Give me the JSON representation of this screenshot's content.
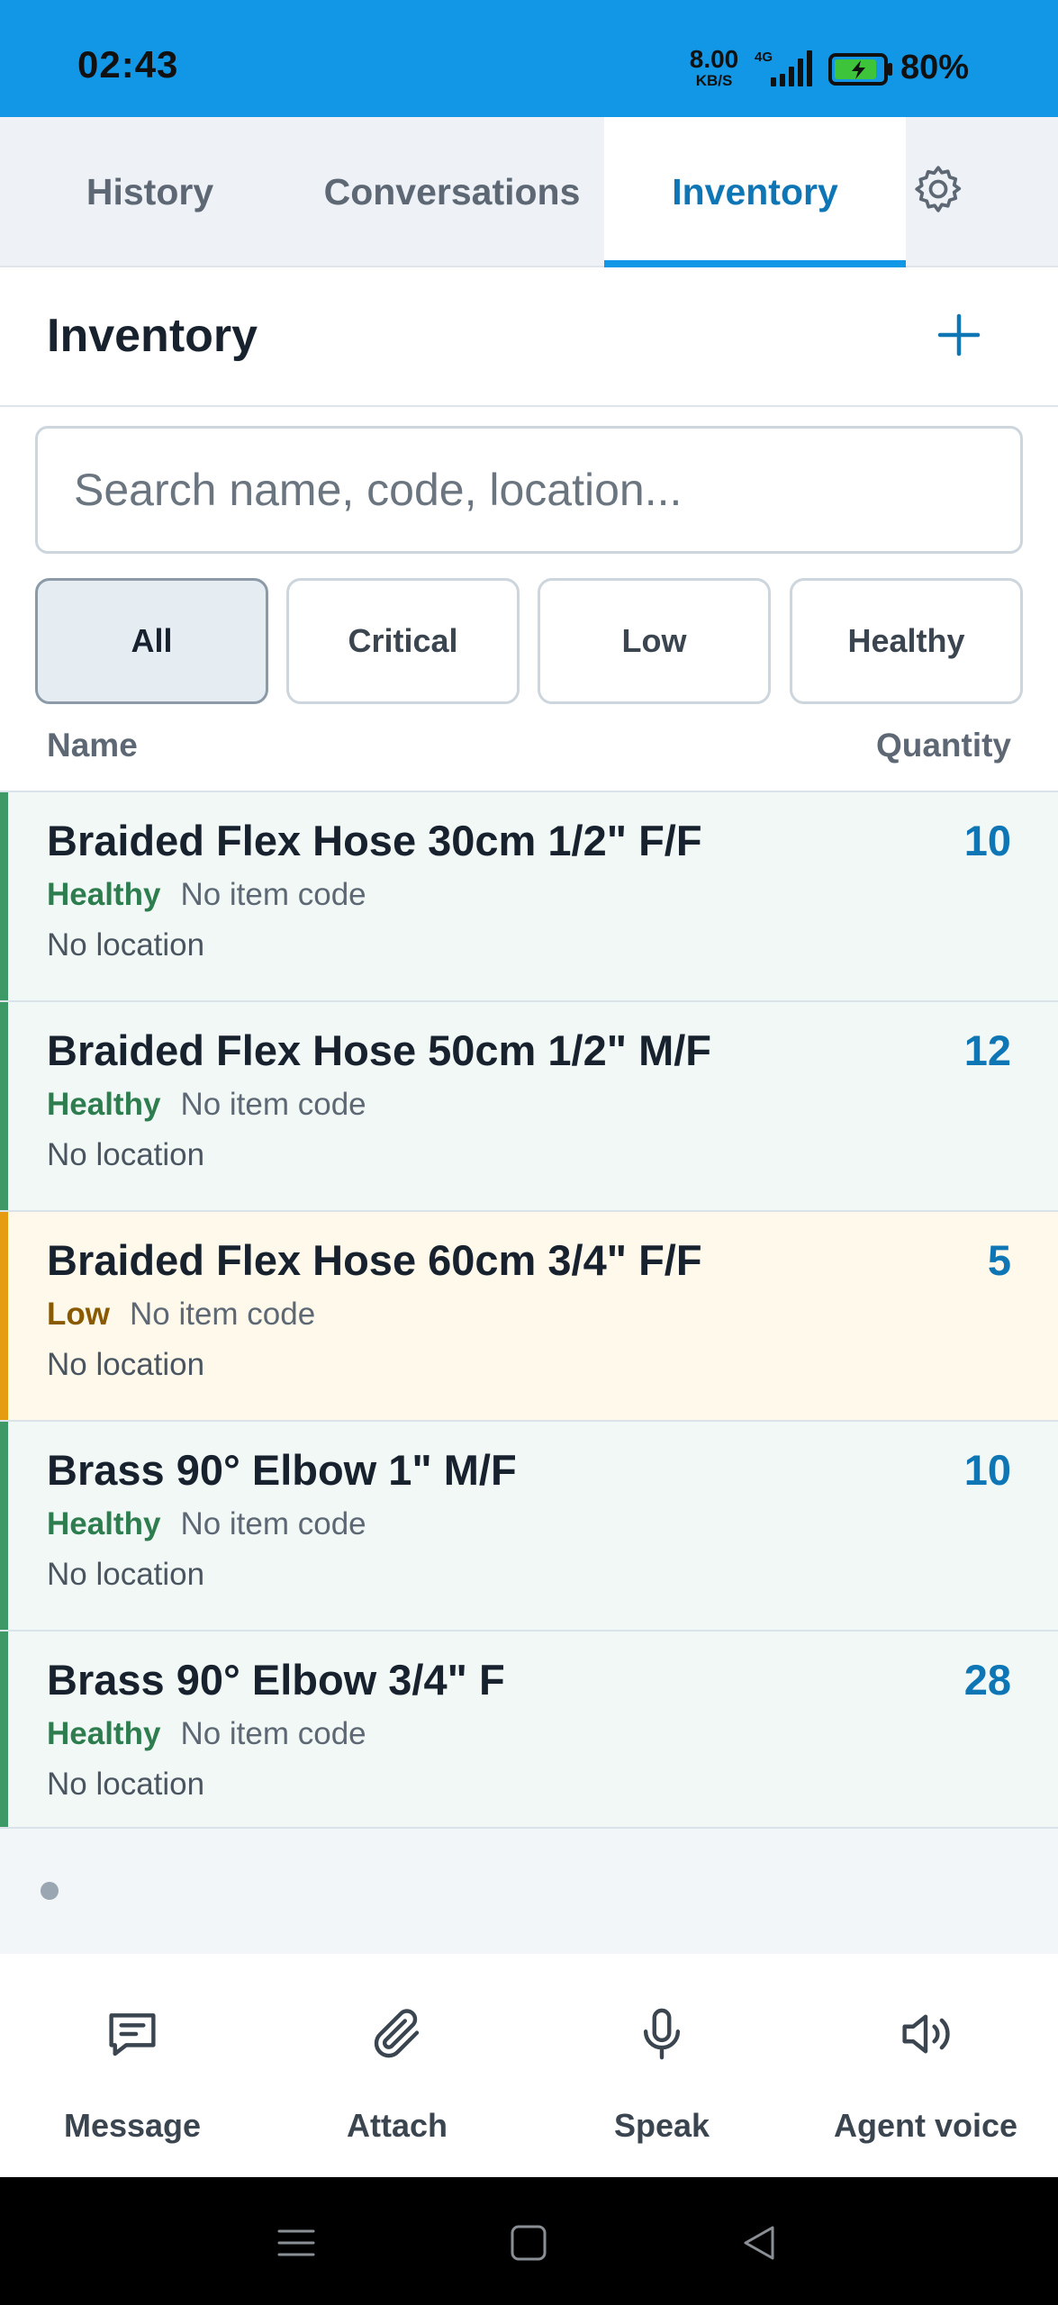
{
  "status_bar": {
    "time": "02:43",
    "net_speed": "8.00",
    "net_unit": "KB/S",
    "network": "4G",
    "battery": "80%"
  },
  "tabs": [
    {
      "label": "History",
      "active": false
    },
    {
      "label": "Conversations",
      "active": false
    },
    {
      "label": "Inventory",
      "active": true
    }
  ],
  "header": {
    "title": "Inventory",
    "add_icon": "plus-icon"
  },
  "search": {
    "placeholder": "Search name, code, location...",
    "value": ""
  },
  "filters": [
    {
      "label": "All",
      "selected": true
    },
    {
      "label": "Critical",
      "selected": false
    },
    {
      "label": "Low",
      "selected": false
    },
    {
      "label": "Healthy",
      "selected": false
    }
  ],
  "columns": {
    "name": "Name",
    "quantity": "Quantity"
  },
  "items": [
    {
      "name": "Braided Flex Hose 30cm 1/2\" F/F",
      "quantity": "10",
      "status": "Healthy",
      "code": "No item code",
      "location": "No location"
    },
    {
      "name": "Braided Flex Hose 50cm 1/2\" M/F",
      "quantity": "12",
      "status": "Healthy",
      "code": "No item code",
      "location": "No location"
    },
    {
      "name": "Braided Flex Hose 60cm 3/4\" F/F",
      "quantity": "5",
      "status": "Low",
      "code": "No item code",
      "location": "No location"
    },
    {
      "name": "Brass 90° Elbow 1\" M/F",
      "quantity": "10",
      "status": "Healthy",
      "code": "No item code",
      "location": "No location"
    },
    {
      "name": "Brass 90° Elbow 3/4\" F",
      "quantity": "28",
      "status": "Healthy",
      "code": "No item code",
      "location": "No location"
    }
  ],
  "status_colors": {
    "Healthy": {
      "text": "#2e7d4f",
      "bar": "#3d9a67",
      "bg": "#f1f8f6"
    },
    "Low": {
      "text": "#8a5a00",
      "bar": "#e59b12",
      "bg": "#fef9ea"
    }
  },
  "actions": [
    {
      "label": "Message",
      "icon": "message-icon"
    },
    {
      "label": "Attach",
      "icon": "paperclip-icon"
    },
    {
      "label": "Speak",
      "icon": "microphone-icon"
    },
    {
      "label": "Agent voice",
      "icon": "speaker-icon"
    }
  ]
}
